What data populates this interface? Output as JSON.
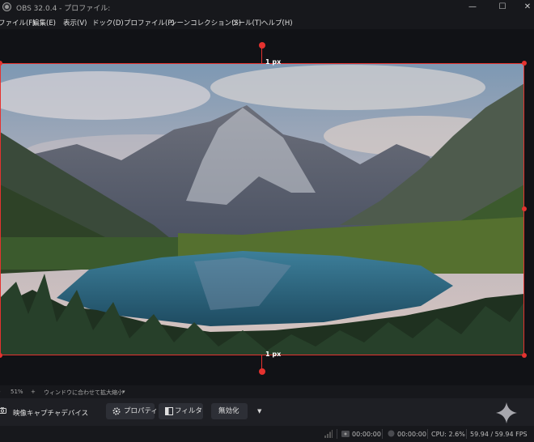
{
  "window": {
    "title": "OBS 32.0.4 - プロファイル:",
    "minimize": "—",
    "maximize": "☐",
    "close": "✕"
  },
  "menu": [
    {
      "label": "ファイル(F)"
    },
    {
      "label": "編集(E)"
    },
    {
      "label": "表示(V)"
    },
    {
      "label": "ドック(D)"
    },
    {
      "label": "プロファイル(P)"
    },
    {
      "label": "シーンコレクション(S)"
    },
    {
      "label": "ツール(T)"
    },
    {
      "label": "ヘルプ(H)"
    }
  ],
  "preview": {
    "top_gap_label": "1 px",
    "bottom_gap_label": "1 px",
    "bbox_color": "#e5322f"
  },
  "zoom": {
    "minus": "-",
    "value": "51%",
    "plus": "+",
    "mode": "ウィンドウに合わせて拡大縮小",
    "dropdown_icon": "▾"
  },
  "source": {
    "name": "映像キャプチャデバイス",
    "buttons": {
      "properties": "プロパティ",
      "filters": "フィルタ",
      "disable": "無効化"
    },
    "more_icon": "▼"
  },
  "status": {
    "stream_time": "00:00:00",
    "record_time": "00:00:00",
    "cpu": "CPU: 2.6%",
    "fps": "59.94 / 59.94 FPS"
  }
}
